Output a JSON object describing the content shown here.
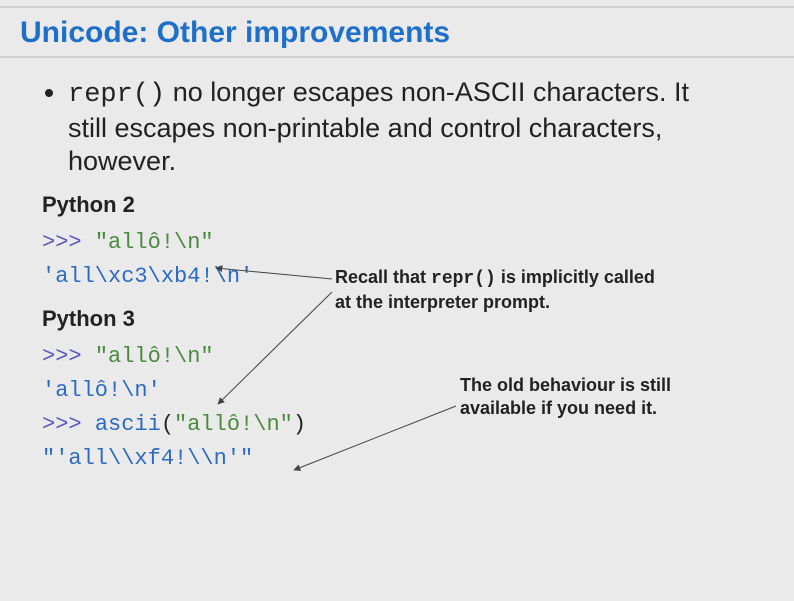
{
  "title": "Unicode: Other improvements",
  "bullet": {
    "code1": "repr()",
    "rest": " no longer escapes non-ASCII characters. It still escapes non-printable and control characters, however."
  },
  "py2": {
    "heading": "Python 2",
    "line1_prompt": ">>> ",
    "line1_str": "\"allô!\\n\"",
    "line2_out": "'all\\xc3\\xb4!\\n'"
  },
  "py3": {
    "heading": "Python 3",
    "line1_prompt": ">>> ",
    "line1_str": "\"allô!\\n\"",
    "line2_out": "'allô!\\n'",
    "line3_prompt": ">>> ",
    "line3_fn": "ascii",
    "line3_open": "(",
    "line3_arg": "\"allô!\\n\"",
    "line3_close": ")",
    "line4_out": "\"'all\\\\xf4!\\\\n'\""
  },
  "note1": {
    "t1": "Recall that ",
    "code": "repr()",
    "t2": " is implicitly called at the interpreter prompt."
  },
  "note2": "The old behaviour is still available if you need it."
}
